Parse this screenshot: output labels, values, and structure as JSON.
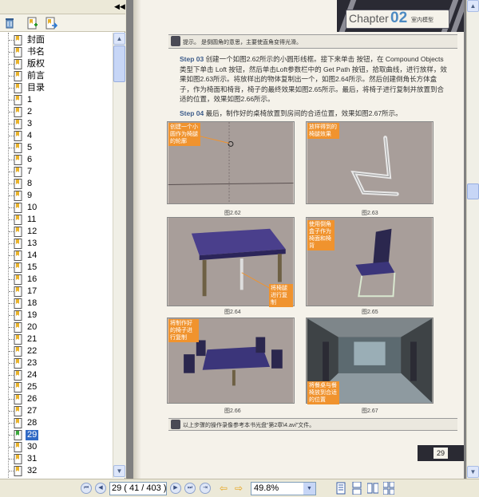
{
  "sidebar": {
    "collapse_icon": "double-left-arrow-icon",
    "tools": [
      "delete-icon",
      "bookmark-add-icon",
      "bookmark-goto-icon"
    ],
    "items": [
      {
        "label": "封面"
      },
      {
        "label": "书名"
      },
      {
        "label": "版权"
      },
      {
        "label": "前言"
      },
      {
        "label": "目录"
      },
      {
        "label": "1"
      },
      {
        "label": "2"
      },
      {
        "label": "3"
      },
      {
        "label": "4"
      },
      {
        "label": "5"
      },
      {
        "label": "6"
      },
      {
        "label": "7"
      },
      {
        "label": "8"
      },
      {
        "label": "9"
      },
      {
        "label": "10"
      },
      {
        "label": "11"
      },
      {
        "label": "12"
      },
      {
        "label": "13"
      },
      {
        "label": "14"
      },
      {
        "label": "15"
      },
      {
        "label": "16"
      },
      {
        "label": "17"
      },
      {
        "label": "18"
      },
      {
        "label": "19"
      },
      {
        "label": "20"
      },
      {
        "label": "21"
      },
      {
        "label": "22"
      },
      {
        "label": "23"
      },
      {
        "label": "24"
      },
      {
        "label": "25"
      },
      {
        "label": "26"
      },
      {
        "label": "27"
      },
      {
        "label": "28"
      },
      {
        "label": "29"
      },
      {
        "label": "30"
      },
      {
        "label": "31"
      },
      {
        "label": "32"
      }
    ],
    "selected_label": "29"
  },
  "document": {
    "chapter_word": "Chapter",
    "chapter_number": "02",
    "chapter_subtitle": "室内模型",
    "tip_text": "提示。        是倒圆角的意思，主要使直角变得光滑。",
    "step1_badge": "Step 03",
    "step1_text": "创建一个如图2.62所示的小圆形线框。接下来单击 按钮，在 Compound Objects 类型下单击 Loft 按钮，然后单击Loft参数栏中的 Get Path 按钮，拾取曲线，进行放样，效果如图2.63所示。将放样出的物体复制出一个，如图2.64所示。然后创建倒角长方体盒子，作为椅面和椅背，椅子的最终效果如图2.65所示。最后，将椅子进行复制并放置到合适的位置，效果如图2.66所示。",
    "step2_badge": "Step 04",
    "step2_text": "最后，制作好的桌椅放置到房间的合适位置，效果如图2.67所示。",
    "figures": [
      {
        "caption": "图2.62",
        "note": "创建一个小圆作为椅腿的轮廓"
      },
      {
        "caption": "图2.63",
        "note": "放样得到的椅腿效果"
      },
      {
        "caption": "图2.64",
        "note": "将椅腿进行复制"
      },
      {
        "caption": "图2.65",
        "note": "使用倒角盒子作为椅面和椅背"
      },
      {
        "caption": "图2.66",
        "note": "将制作好的椅子进行复制"
      },
      {
        "caption": "图2.67",
        "note": "将餐桌与餐椅放到合适的位置"
      }
    ],
    "bottom_text": "以上步骤的操作录像参考本书光盘“第2章\\4.avi”文件。",
    "page_corner_number": "29"
  },
  "statusbar": {
    "page_field": "29 ( 41 / 403 )",
    "zoom_value": "49.8%"
  },
  "colors": {
    "selection": "#316ac5",
    "note_orange": "#f0932e",
    "chapter_blue": "#4c8ac2"
  }
}
